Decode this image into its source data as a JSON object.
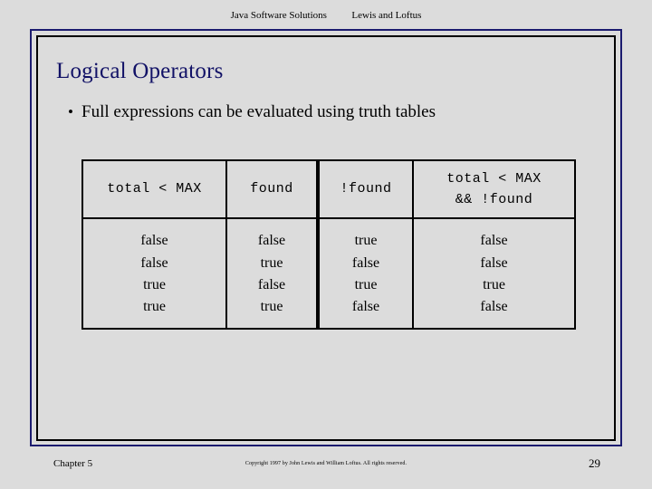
{
  "running_header": {
    "book_title": "Java Software Solutions",
    "authors": "Lewis and Loftus"
  },
  "slide": {
    "title": "Logical Operators",
    "title_color": "#111166",
    "frame_outer_color": "#1b1b6f",
    "frame_inner_color": "#000000",
    "background_color": "#dcdcdc",
    "bullets": [
      {
        "marker": "•",
        "text": "Full expressions can be evaluated using truth tables"
      }
    ],
    "truth_table": {
      "headers": [
        {
          "lines": [
            "total < MAX"
          ]
        },
        {
          "lines": [
            "found"
          ]
        },
        {
          "lines": [
            "!found"
          ]
        },
        {
          "lines": [
            "total < MAX",
            "&& !found"
          ]
        }
      ],
      "columns": [
        {
          "values": [
            "false",
            "false",
            "true",
            "true"
          ]
        },
        {
          "values": [
            "false",
            "true",
            "false",
            "true"
          ]
        },
        {
          "values": [
            "true",
            "false",
            "true",
            "false"
          ]
        },
        {
          "values": [
            "false",
            "false",
            "true",
            "false"
          ]
        }
      ]
    }
  },
  "footer": {
    "chapter": "Chapter 5",
    "copyright": "Copyright 1997 by John Lewis and William Loftus.  All rights reserved.",
    "page_number": "29"
  }
}
